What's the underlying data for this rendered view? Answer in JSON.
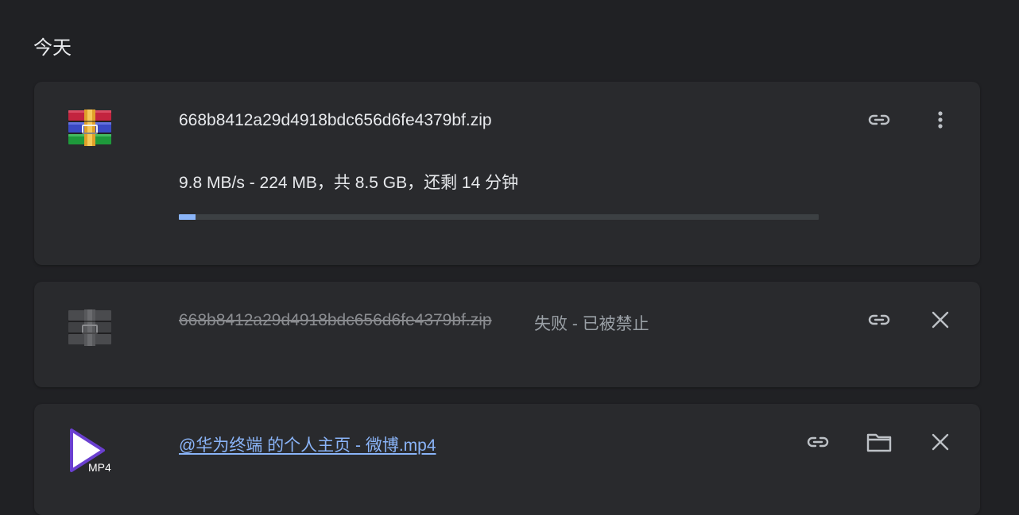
{
  "section": {
    "title": "今天"
  },
  "downloads": [
    {
      "filename": "668b8412a29d4918bdc656d6fe4379bf.zip",
      "status": "9.8 MB/s - 224 MB，共 8.5 GB，还剩 14 分钟",
      "progress_percent": 2.6,
      "icon": "winrar-archive-icon"
    },
    {
      "filename": "668b8412a29d4918bdc656d6fe4379bf.zip",
      "status": "失败 - 已被禁止",
      "icon": "winrar-archive-icon-greyed"
    },
    {
      "filename": "@华为终端 的个人主页 - 微博.mp4",
      "icon_label": "MP4",
      "icon": "mp4-video-icon"
    }
  ],
  "colors": {
    "background": "#202124",
    "card": "#292a2d",
    "text": "#e8eaed",
    "muted": "#9aa0a6",
    "link": "#8ab4f8",
    "progress_track": "#3c4043",
    "progress_fill": "#8ab4f8"
  }
}
